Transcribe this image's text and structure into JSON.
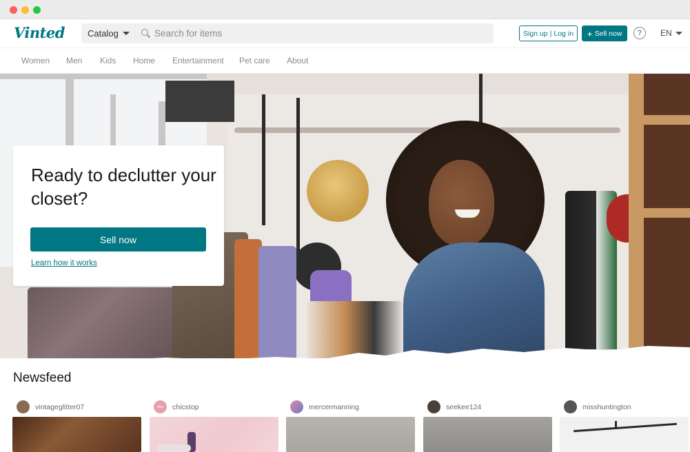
{
  "header": {
    "logo": "Vinted",
    "catalog_label": "Catalog",
    "search_placeholder": "Search for items",
    "signup_label": "Sign up",
    "auth_separator": "|",
    "login_label": "Log in",
    "sell_label": "Sell now",
    "help_glyph": "?",
    "language": "EN"
  },
  "nav": {
    "items": [
      "Women",
      "Men",
      "Kids",
      "Home",
      "Entertainment",
      "Pet care",
      "About"
    ]
  },
  "hero": {
    "title": "Ready to declutter your closet?",
    "sell_button": "Sell now",
    "learn_link": "Learn how it works"
  },
  "newsfeed": {
    "title": "Newsfeed",
    "items": [
      {
        "username": "vintageglitter07",
        "avatar_color": "#8a6a55",
        "thumb_color": "#6a3f25"
      },
      {
        "username": "chicstop",
        "avatar_color": "#e8a0a8",
        "avatar_text": "chic",
        "thumb_color": "#f2cfd3"
      },
      {
        "username": "mercermanning",
        "avatar_color": "#8d7bb8",
        "thumb_color": "#b9b6b1"
      },
      {
        "username": "seekee124",
        "avatar_color": "#4a4035",
        "thumb_color": "#9a9894"
      },
      {
        "username": "misshuntington",
        "avatar_color": "#555555",
        "thumb_color": "#f2f2f2"
      }
    ]
  },
  "colors": {
    "brand": "#007782"
  }
}
